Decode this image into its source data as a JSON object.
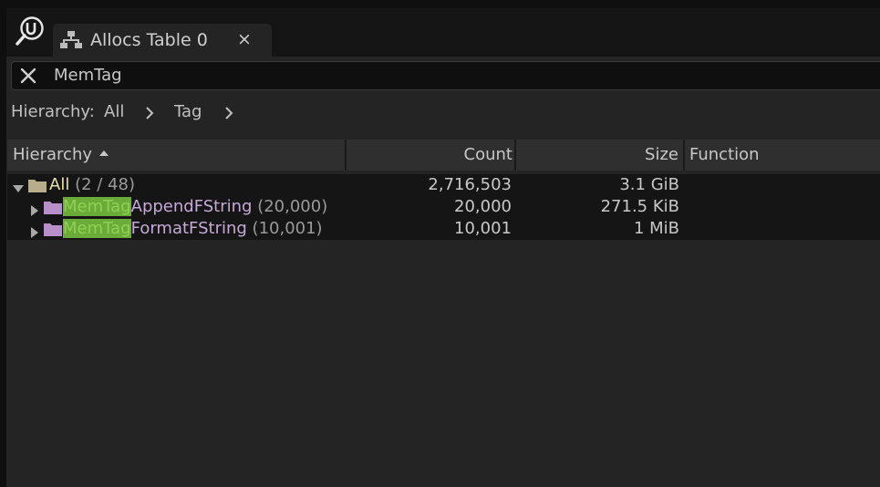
{
  "window": {
    "tab": {
      "title": "Allocs Table 0",
      "close_label": "×"
    }
  },
  "search": {
    "value": "MemTag"
  },
  "breadcrumbs": {
    "label": "Hierarchy:",
    "items": [
      "All",
      "Tag"
    ],
    "separator": ">"
  },
  "table": {
    "columns": [
      "Hierarchy",
      "Count",
      "Size",
      "Function"
    ],
    "sort": {
      "column": "Hierarchy",
      "direction": "ascending"
    },
    "rows": [
      {
        "name": "All",
        "detail": "(2 / 48)",
        "count": "2,716,503",
        "size": "3.1 GiB",
        "expanded": true
      },
      {
        "match": "MemTag",
        "rest": "AppendFString",
        "detail": "(20,000)",
        "count": "20,000",
        "size": "271.5 KiB",
        "expanded": false
      },
      {
        "match": "MemTag",
        "rest": "FormatFString",
        "detail": "(10,001)",
        "count": "10,001",
        "size": "1 MiB",
        "expanded": false
      }
    ]
  },
  "colors": {
    "highlight": "#6aab3a",
    "function_name": "#c6a9d6",
    "group_name": "#e8e0b0"
  },
  "icons": [
    "unreal-logo-icon",
    "tree-table-icon",
    "close-icon",
    "clear-search-icon",
    "chevron-right-icon",
    "sort-ascending-icon",
    "expand-arrow-icon",
    "folder-icon"
  ]
}
